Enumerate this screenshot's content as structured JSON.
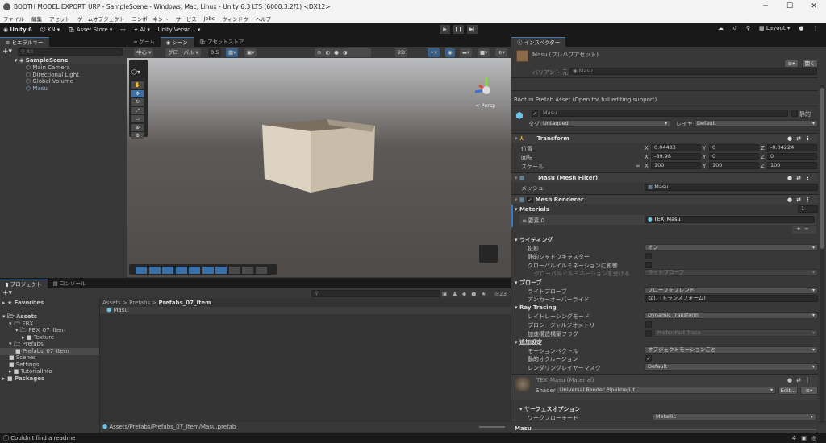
{
  "window": {
    "title": "BOOTH MODEL EXPORT_URP - SampleScene - Windows, Mac, Linux - Unity 6.3 LTS (6000.3.2f1) <DX12>",
    "minimize": "─",
    "maximize": "☐",
    "close": "✕"
  },
  "menu": [
    "ファイル",
    "編集",
    "アセット",
    "ゲームオブジェクト",
    "コンポーネント",
    "サービス",
    "Jobs",
    "ウィンドウ",
    "ヘルプ"
  ],
  "toolbar": {
    "unity": "Unity 6",
    "account": "KN ▾",
    "asset_store": "Asset Store ▾",
    "ai": "✦ AI ▾",
    "version_control": "Unity Versio... ▾",
    "play": "▶",
    "pause": "❚❚",
    "step": "▶|",
    "layout": "Layout ▾"
  },
  "hierarchy": {
    "tab": "ヒエラルキー",
    "search_placeholder": "All",
    "scene": "SampleScene",
    "items": [
      "Main Camera",
      "Directional Light",
      "Global Volume",
      "Masu"
    ]
  },
  "scene": {
    "tabs": [
      "ゲーム",
      "シーン",
      "アセットストア"
    ],
    "pivot": "中心 ▾",
    "space": "グローバル ▾",
    "snap": "0.5",
    "mode2d": "2D",
    "persp": "< Persp",
    "axis_x": "x",
    "axis_y": "y",
    "axis_z": "z"
  },
  "project": {
    "tabs": [
      "プロジェクト",
      "コンソール"
    ],
    "count": "23",
    "breadcrumb": [
      "Assets",
      "Prefabs",
      "Prefabs_07_Item"
    ],
    "sep": ">",
    "favorites": "Favorites",
    "tree": [
      {
        "label": "Assets",
        "d": 0,
        "open": true
      },
      {
        "label": "FBX",
        "d": 1,
        "open": true
      },
      {
        "label": "FBX_07_Item",
        "d": 2,
        "open": true
      },
      {
        "label": "Texture",
        "d": 3
      },
      {
        "label": "Prefabs",
        "d": 1,
        "open": true
      },
      {
        "label": "Prefabs_07_Item",
        "d": 2,
        "sel": true
      },
      {
        "label": "Scenes",
        "d": 1
      },
      {
        "label": "Settings",
        "d": 1
      },
      {
        "label": "TutorialInfo",
        "d": 1
      },
      {
        "label": "Packages",
        "d": 0
      }
    ],
    "files": [
      "Masu"
    ],
    "path": "Assets/Prefabs/Prefabs_07_Item/Masu.prefab"
  },
  "inspector": {
    "tab": "インスペクター",
    "asset_title": "Masu (プレハブアセット)",
    "open_btn": "開く",
    "variant_label": "バリアント 元",
    "variant_value": "Masu",
    "root_note": "Root in Prefab Asset (Open for full editing support)",
    "object_name": "Masu",
    "static": "静的",
    "tag_label": "タグ",
    "tag": "Untagged",
    "layer_label": "レイヤー",
    "layer": "Default",
    "transform": {
      "title": "Transform",
      "position_label": "位置",
      "rotation_label": "回転",
      "scale_label": "スケール",
      "position": [
        "0.04483",
        "0",
        "-0.04224"
      ],
      "rotation": [
        "-89.98",
        "0",
        "0"
      ],
      "scale": [
        "100",
        "100",
        "100"
      ],
      "axes": [
        "X",
        "Y",
        "Z"
      ]
    },
    "mesh_filter": {
      "title": "Masu (Mesh Filter)",
      "mesh_label": "メッシュ",
      "mesh": "Masu"
    },
    "mesh_renderer": {
      "title": "Mesh Renderer",
      "materials": "Materials",
      "count": "1",
      "element_label": "要素 0",
      "element": "TEX_Masu",
      "add": "+",
      "remove": "−"
    },
    "props": [
      {
        "t": "s",
        "l": "ライティング"
      },
      {
        "l": "投影",
        "v": "オン",
        "k": "dd"
      },
      {
        "l": "静的シャドウキャスター",
        "k": "chk"
      },
      {
        "l": "グローバルイルミネーションに影響",
        "k": "chk"
      },
      {
        "l": "グローバルイルミネーションを受ける",
        "v": "ライトプローブ",
        "k": "dd",
        "dim": true,
        "ind": true
      },
      {
        "t": "s",
        "l": "プローブ"
      },
      {
        "l": "ライトプローブ",
        "v": "プローブをブレンド",
        "k": "dd"
      },
      {
        "l": "アンカーオーバーライド",
        "v": "なし (トランスフォーム)",
        "k": "obj"
      },
      {
        "t": "s",
        "l": "Ray Tracing"
      },
      {
        "l": "レイトレーシングモード",
        "v": "Dynamic Transform",
        "k": "dd"
      },
      {
        "l": "プロシージャルジオメトリ",
        "k": "chk"
      },
      {
        "l": "加速構造構築フラグ",
        "v": "Prefer Fast Trace",
        "k": "chkdd"
      },
      {
        "t": "s",
        "l": "追加設定"
      },
      {
        "l": "モーションベクトル",
        "v": "オブジェクトモーションごと",
        "k": "dd"
      },
      {
        "l": "動的オクルージョン",
        "k": "chk",
        "on": true
      },
      {
        "l": "レンダリングレイヤーマスク",
        "v": "Default",
        "k": "dd"
      }
    ],
    "material": {
      "title": "TEX_Masu (Material)",
      "shader_label": "Shader",
      "shader": "Universal Render Pipeline/Lit",
      "edit": "Edit...",
      "surface": "サーフェスオプション",
      "workflow_label": "ワークフローモード",
      "workflow": "Metallic"
    },
    "preview": "Masu"
  },
  "status": {
    "message": "Couldn't find a readme"
  },
  "colors": {
    "accent": "#3a79bb",
    "panel": "#383838",
    "dark": "#191919",
    "selected": "#2c5d87"
  }
}
